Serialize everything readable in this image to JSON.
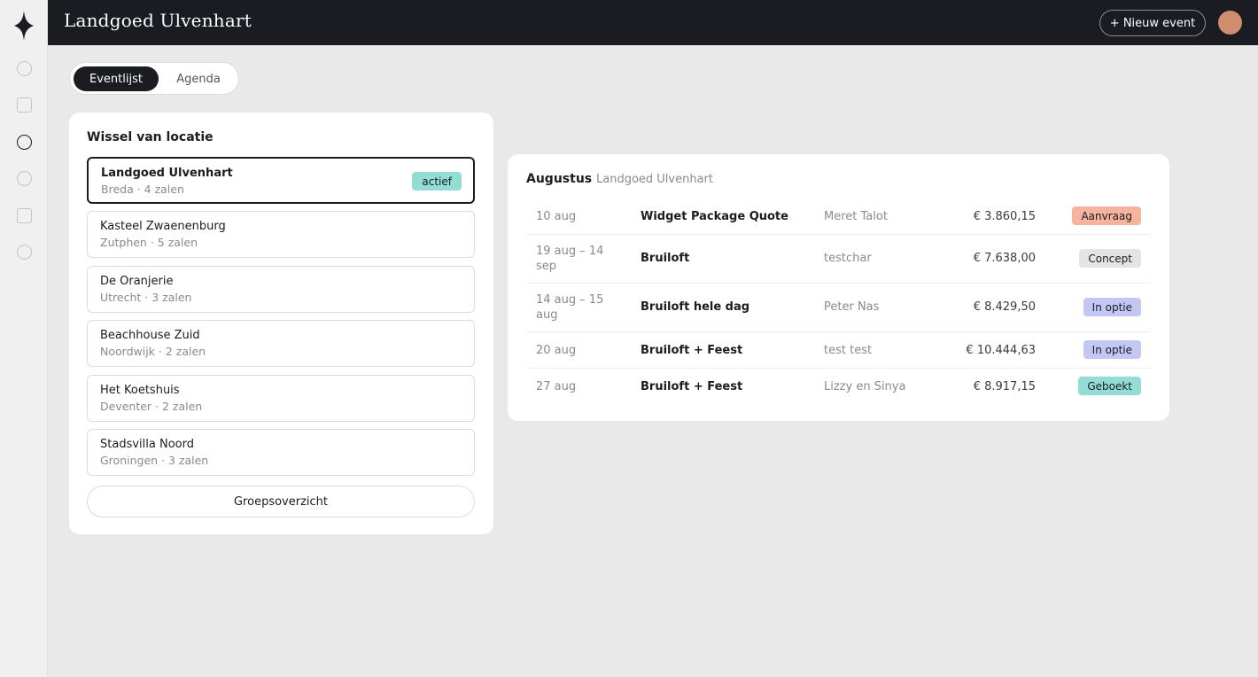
{
  "app": {
    "title": "Landgoed Ulvenhart",
    "new_event_label": "+ Nieuw event"
  },
  "sidebar": {
    "icons": [
      "circle-nav-icon",
      "square-nav-icon",
      "circle-nav-icon-active",
      "circle-nav-icon",
      "square-nav-icon",
      "circle-nav-icon"
    ]
  },
  "tabs": [
    {
      "label": "Eventlijst",
      "active": true
    },
    {
      "label": "Agenda",
      "active": false
    }
  ],
  "locations": {
    "title": "Wissel van locatie",
    "items": [
      {
        "name": "Landgoed Ulvenhart",
        "sub": "Breda · 4 zalen",
        "badge": "actief"
      },
      {
        "name": "Kasteel Zwaenenburg",
        "sub": "Zutphen · 5 zalen"
      },
      {
        "name": "De Oranjerie",
        "sub": "Utrecht · 3 zalen"
      },
      {
        "name": "Beachhouse Zuid",
        "sub": "Noordwijk · 2 zalen"
      },
      {
        "name": "Het Koetshuis",
        "sub": "Deventer · 2 zalen"
      },
      {
        "name": "Stadsvilla Noord",
        "sub": "Groningen · 3 zalen"
      }
    ],
    "group_button": "Groepsoverzicht"
  },
  "events": {
    "month": "Augustus",
    "location": "Landgoed Ulvenhart",
    "rows": [
      {
        "date": "10 aug",
        "name": "Widget Package Quote",
        "person": "Meret Talot",
        "amount": "€ 3.860,15",
        "status": "Aanvraag"
      },
      {
        "date": "19 aug – 14 sep",
        "name": "Bruiloft",
        "person": "testchar",
        "amount": "€ 7.638,00",
        "status": "Concept"
      },
      {
        "date": "14 aug – 15 aug",
        "name": "Bruiloft hele dag",
        "person": "Peter Nas",
        "amount": "€ 8.429,50",
        "status": "In optie"
      },
      {
        "date": "20 aug",
        "name": "Bruiloft + Feest",
        "person": "test test",
        "amount": "€ 10.444,63",
        "status": "In optie"
      },
      {
        "date": "27 aug",
        "name": "Bruiloft + Feest",
        "person": "Lizzy en Sinya",
        "amount": "€ 8.917,15",
        "status": "Geboekt"
      }
    ]
  },
  "colors": {
    "topbar": "#1b1b22",
    "status_aanvraag": "#f6b39e",
    "status_concept": "#e4e4e4",
    "status_optie": "#c3c7f4",
    "status_geboekt": "#93ddd5",
    "avatar": "#cf8c6e"
  }
}
